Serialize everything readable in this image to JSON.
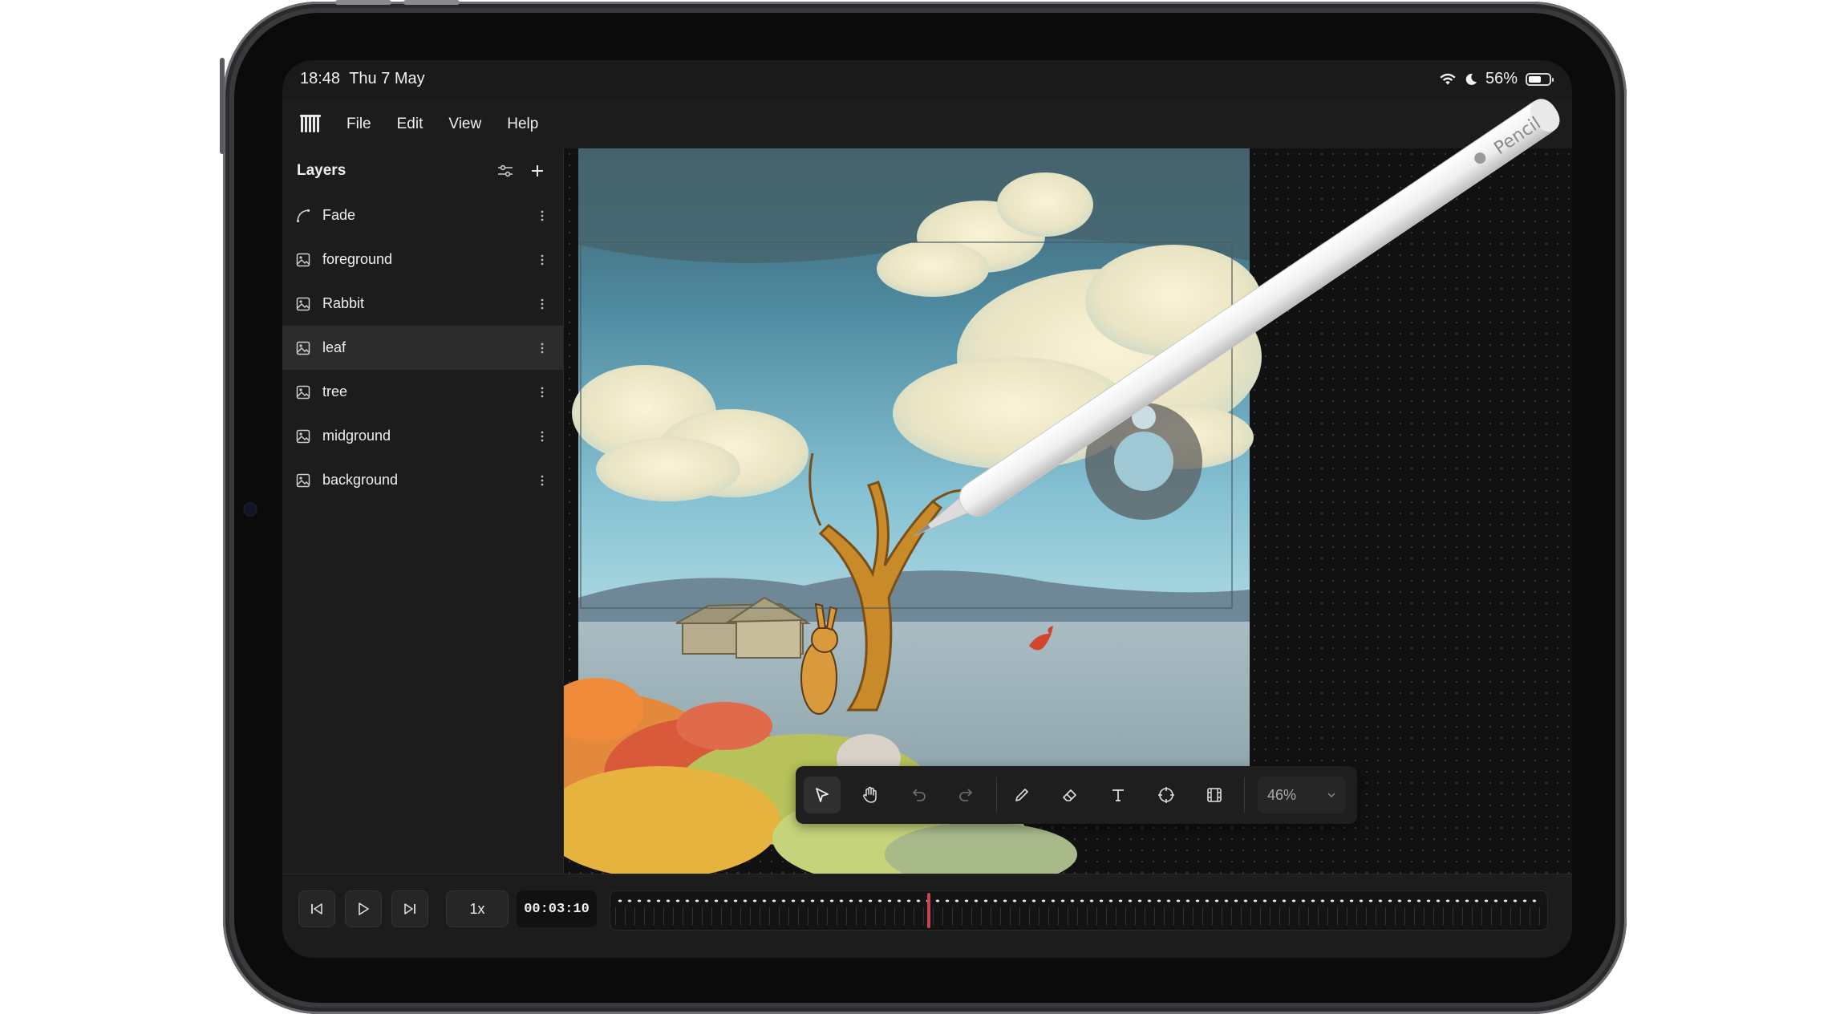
{
  "status_bar": {
    "time": "18:48",
    "date": "Thu 7 May",
    "battery": "56%",
    "battery_level": 0.56
  },
  "menu": {
    "items": [
      "File",
      "Edit",
      "View",
      "Help"
    ]
  },
  "layers": {
    "title": "Layers",
    "items": [
      {
        "name": "Fade",
        "icon": "curve-icon",
        "active": false
      },
      {
        "name": "foreground",
        "icon": "image-icon",
        "active": false
      },
      {
        "name": "Rabbit",
        "icon": "image-icon",
        "active": false
      },
      {
        "name": "leaf",
        "icon": "image-icon",
        "active": true
      },
      {
        "name": "tree",
        "icon": "image-icon",
        "active": false
      },
      {
        "name": "midground",
        "icon": "image-icon",
        "active": false
      },
      {
        "name": "background",
        "icon": "image-icon",
        "active": false
      }
    ]
  },
  "toolbar": {
    "tools": [
      "select-tool",
      "hand-tool",
      "undo",
      "redo",
      "pen-tool",
      "eraser-tool",
      "text-tool",
      "target-tool",
      "film-tool"
    ],
    "active_tool": "select-tool",
    "zoom": "46%"
  },
  "timeline": {
    "speed": "1x",
    "time": "00:03:10",
    "playhead_fraction": 0.338
  },
  "pencil": {
    "brand": "Pencil"
  },
  "colors": {
    "accent_playhead": "#c3434f",
    "panel": "#1c1c1c"
  }
}
